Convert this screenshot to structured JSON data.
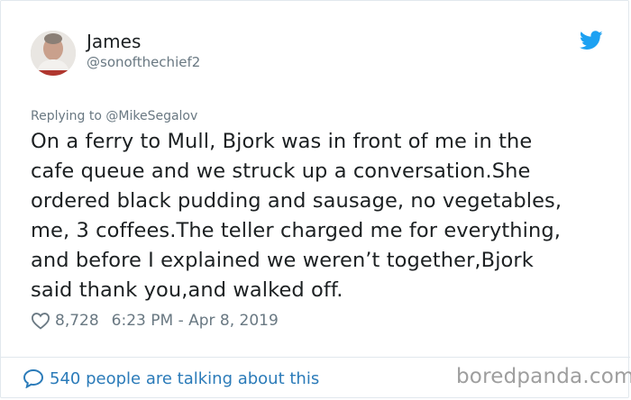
{
  "tweet": {
    "author_name": "James",
    "author_handle": "@sonofthechief2",
    "replying_prefix": "Replying to",
    "replying_to": "@MikeSegalov",
    "text_lines": [
      "On a ferry to Mull, Bjork was in front of me in the",
      "cafe queue and we struck up a conversation.She",
      "ordered black pudding and sausage, no vegetables,",
      "me, 3 coffees.The teller charged me for everything,",
      "and before I explained we weren’t together,Bjork",
      "said thank you,and walked off."
    ],
    "likes": "8,728",
    "timestamp": "6:23 PM - Apr 8, 2019",
    "conversation_link": "540 people are talking about this"
  },
  "icons": {
    "platform": "twitter-bird-icon",
    "like": "heart-icon",
    "reply": "speech-bubble-icon"
  },
  "colors": {
    "twitter_blue": "#1da1f2",
    "link_blue": "#2b7bb9",
    "muted_text": "#697882"
  },
  "watermark": "boredpanda.com"
}
